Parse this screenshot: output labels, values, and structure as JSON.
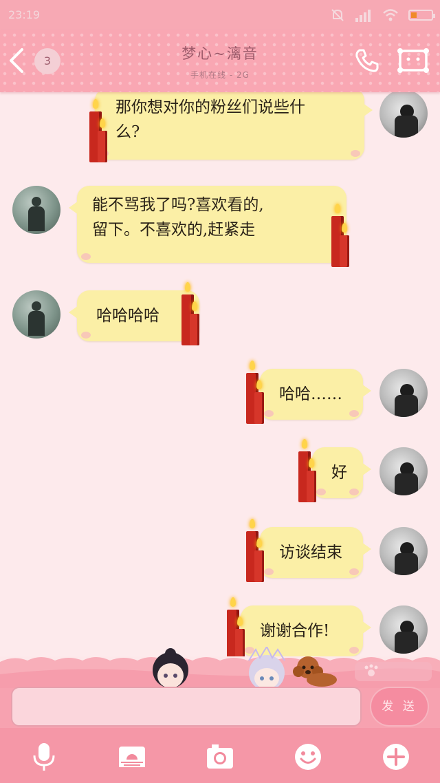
{
  "status_bar": {
    "time": "23:19",
    "battery_level": 0.3
  },
  "header": {
    "back_icon": "chevron-left-icon",
    "unread_count": "3",
    "contact_name": "梦心~漓音",
    "contact_status": "手机在线 - 2G",
    "call_icon": "phone-icon",
    "profile_icon": "profile-card-icon"
  },
  "messages": [
    {
      "side": "sent",
      "text_lines": [
        "那你想对你的粉丝们说些什",
        "么?"
      ]
    },
    {
      "side": "received",
      "text_lines": [
        "能不骂我了吗?喜欢看的,",
        "留下。不喜欢的,赶紧走"
      ]
    },
    {
      "side": "received",
      "text_lines": [
        "哈哈哈哈"
      ]
    },
    {
      "side": "sent",
      "text_lines": [
        "哈哈……"
      ]
    },
    {
      "side": "sent",
      "text_lines": [
        "好"
      ]
    },
    {
      "side": "sent",
      "text_lines": [
        "访谈结束"
      ]
    },
    {
      "side": "sent",
      "text_lines": [
        "谢谢合作!"
      ]
    }
  ],
  "composer": {
    "input_value": "",
    "send_label": "发 送"
  },
  "toolbar": {
    "icons": [
      "microphone-icon",
      "image-icon",
      "camera-icon",
      "emoji-icon",
      "plus-icon"
    ]
  },
  "colors": {
    "header": "#f9a7b3",
    "bubble": "#fbefa6",
    "chat_background": "#fdeaec",
    "toolbar": "#f597a7"
  }
}
